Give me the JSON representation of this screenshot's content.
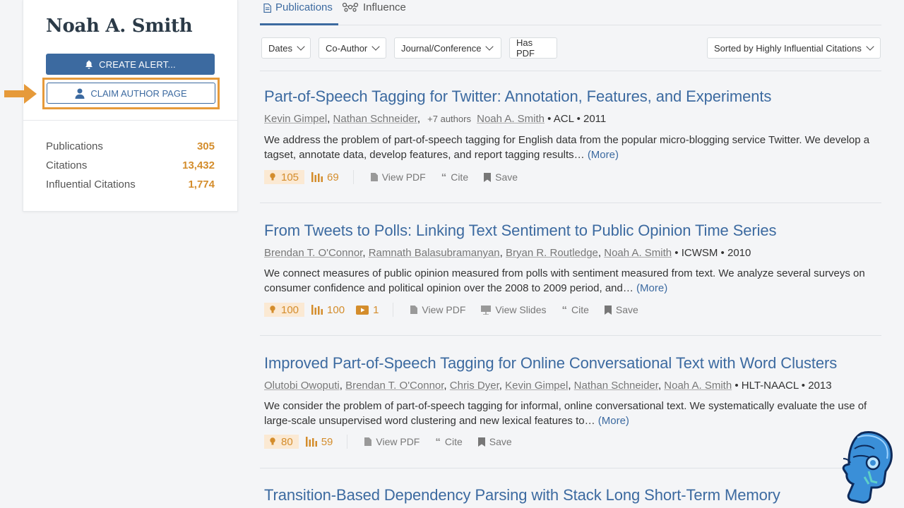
{
  "author": {
    "name": "Noah A. Smith",
    "create_alert_label": "CREATE ALERT...",
    "claim_label": "CLAIM AUTHOR PAGE",
    "stats": [
      {
        "label": "Publications",
        "value": "305"
      },
      {
        "label": "Citations",
        "value": "13,432"
      },
      {
        "label": "Influential Citations",
        "value": "1,774"
      }
    ]
  },
  "tabs": {
    "publications": "Publications",
    "influence": "Influence"
  },
  "filters": {
    "dates": "Dates",
    "coauthor": "Co-Author",
    "journal": "Journal/Conference",
    "has_pdf": "Has PDF",
    "sort": "Sorted by Highly Influential Citations"
  },
  "papers": [
    {
      "title": "Part-of-Speech Tagging for Twitter: Annotation, Features, and Experiments",
      "authors": [
        "Kevin Gimpel",
        "Nathan Schneider"
      ],
      "more_authors": "+7 authors",
      "last_author": "Noah A. Smith",
      "venue": "ACL",
      "year": "2011",
      "abstract": "We address the problem of part-of-speech tagging for English data from the popular micro-blogging service Twitter. We develop a tagset, annotate data, develop features, and report tagging results…",
      "more": "(More)",
      "influential": "105",
      "citations": "69",
      "view_pdf": "View PDF",
      "cite": "Cite",
      "save": "Save"
    },
    {
      "title": "From Tweets to Polls: Linking Text Sentiment to Public Opinion Time Series",
      "authors": [
        "Brendan T. O'Connor",
        "Ramnath Balasubramanyan",
        "Bryan R. Routledge",
        "Noah A. Smith"
      ],
      "venue": "ICWSM",
      "year": "2010",
      "abstract": "We connect measures of public opinion measured from polls with sentiment measured from text. We analyze several surveys on consumer confidence and political opinion over the 2008 to 2009 period, and…",
      "more": "(More)",
      "influential": "100",
      "citations": "100",
      "videos": "1",
      "view_pdf": "View PDF",
      "view_slides": "View Slides",
      "cite": "Cite",
      "save": "Save"
    },
    {
      "title": "Improved Part-of-Speech Tagging for Online Conversational Text with Word Clusters",
      "authors": [
        "Olutobi Owoputi",
        "Brendan T. O'Connor",
        "Chris Dyer",
        "Kevin Gimpel",
        "Nathan Schneider",
        "Noah A. Smith"
      ],
      "venue": "HLT-NAACL",
      "year": "2013",
      "abstract": "We consider the problem of part-of-speech tagging for informal, online conversational text. We systematically evaluate the use of large-scale unsupervised word clustering and new lexical features to…",
      "more": "(More)",
      "influential": "80",
      "citations": "59",
      "view_pdf": "View PDF",
      "cite": "Cite",
      "save": "Save"
    },
    {
      "title": "Transition-Based Dependency Parsing with Stack Long Short-Term Memory"
    }
  ],
  "colors": {
    "accent": "#3c6aa0",
    "influence_orange": "#d48d2c",
    "highlight_box": "#e69a3a"
  }
}
